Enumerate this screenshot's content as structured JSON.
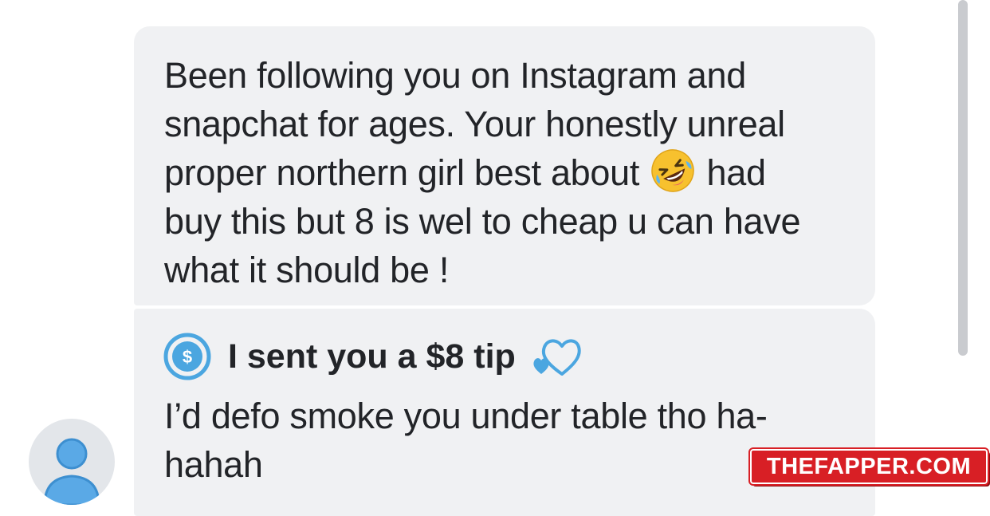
{
  "chat": {
    "message_1": {
      "line_1": "Been following you on Instagram and",
      "line_2": "snapchat for ages. Your honestly unreal",
      "line_3_before_emoji": "proper northern girl best about",
      "emoji_name": "rolling-on-the-floor-laughing-emoji",
      "line_3_after_emoji": "had",
      "line_4": "buy this but 8 is wel to cheap u can have",
      "line_5": "what it should be !"
    },
    "message_2": {
      "tip_label": "I sent you a $8 tip",
      "tip_icon": "dollar-circle-icon",
      "heart_icon": "blue-hearts-icon",
      "line_1": "I’d defo smoke you under table tho ha-",
      "line_2": "hahah"
    },
    "avatar_icon": "user-avatar-icon"
  },
  "watermark": {
    "text": "THEFAPPER.COM"
  },
  "colors": {
    "bubble_bg": "#f0f1f3",
    "text": "#222428",
    "accent_blue": "#4ba6e0",
    "avatar_bg": "#e3e6ea",
    "watermark_red": "#d81f25"
  }
}
